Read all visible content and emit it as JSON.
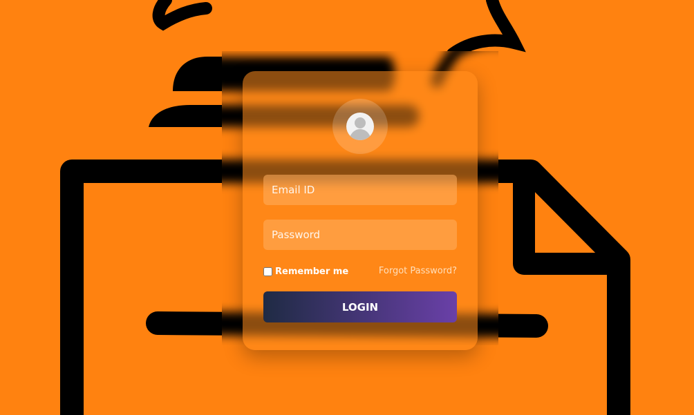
{
  "background": {
    "color": "#ff8210",
    "illustration": "document-with-lines"
  },
  "login_card": {
    "avatar_icon": "user-avatar-icon",
    "email_placeholder": "Email ID",
    "email_value": "",
    "password_placeholder": "Password",
    "password_value": "",
    "remember_label": "Remember me",
    "remember_checked": false,
    "forgot_label": "Forgot Password?",
    "login_label": "LOGIN",
    "button_gradient": [
      "#1f2b44",
      "#6a40a8"
    ]
  }
}
